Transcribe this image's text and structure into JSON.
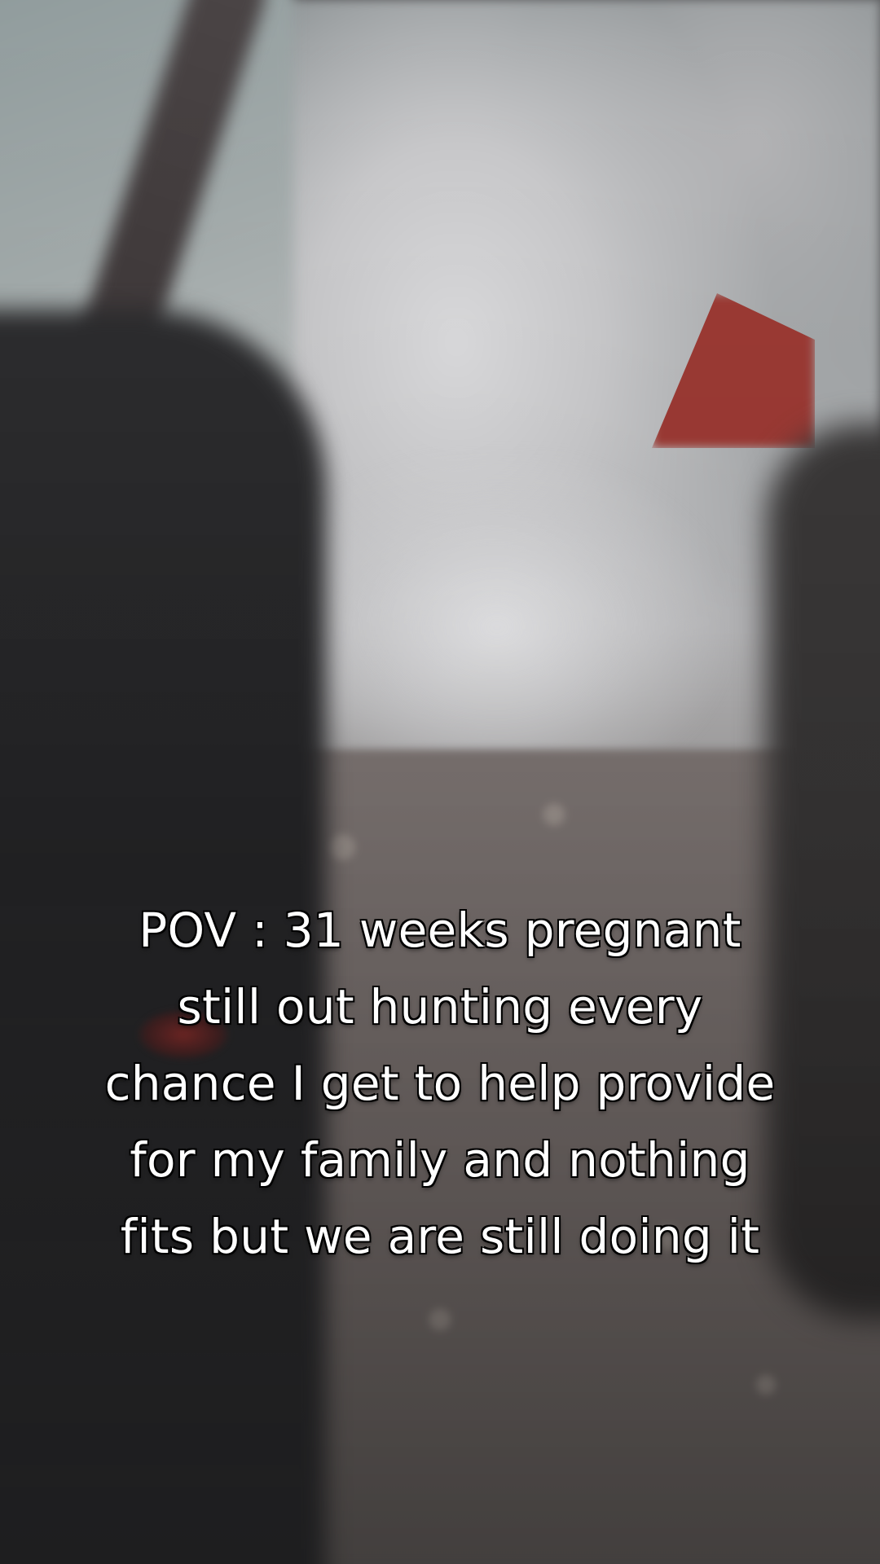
{
  "caption": {
    "lines": [
      "POV : 31 weeks pregnant",
      "still out hunting every",
      "chance I get to help provide",
      "for my family and nothing",
      "fits but we are still doing it"
    ]
  }
}
